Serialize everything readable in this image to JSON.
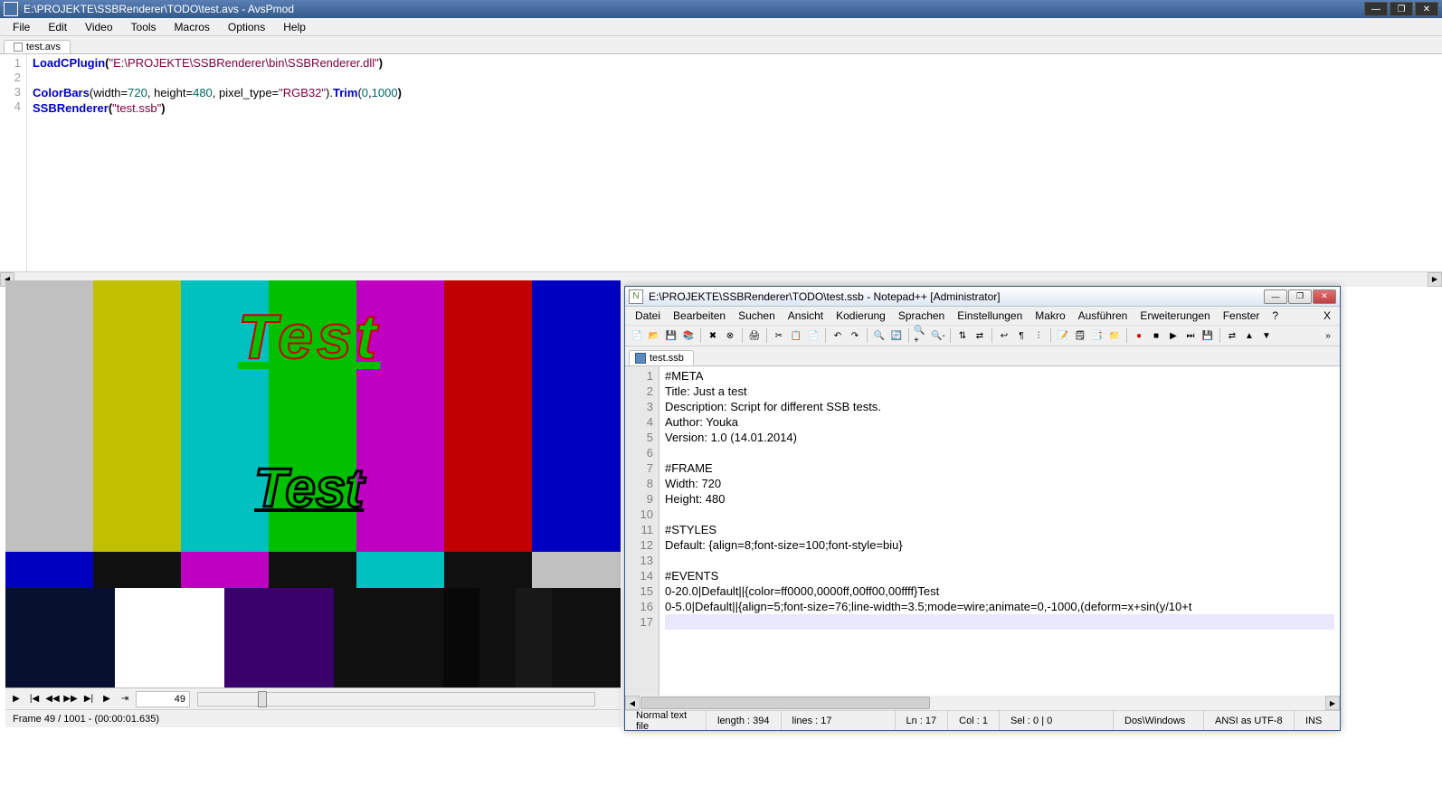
{
  "avspmod": {
    "title": "E:\\PROJEKTE\\SSBRenderer\\TODO\\test.avs - AvsPmod",
    "menu": [
      "File",
      "Edit",
      "Video",
      "Tools",
      "Macros",
      "Options",
      "Help"
    ],
    "tab": "test.avs",
    "code": {
      "line1_fn": "LoadCPlugin",
      "line1_str": "\"E:\\PROJEKTE\\SSBRenderer\\bin\\SSBRenderer.dll\"",
      "line3_fn1": "ColorBars",
      "line3_args_a": "(width=",
      "line3_w": "720",
      "line3_args_b": ", height=",
      "line3_h": "480",
      "line3_args_c": ", pixel_type=",
      "line3_pt": "\"RGB32\"",
      "line3_args_d": ").",
      "line3_fn2": "Trim",
      "line3_args_e": "(",
      "line3_t0": "0",
      "line3_comma": ",",
      "line3_t1": "1000",
      "line3_close": ")",
      "line4_fn": "SSBRenderer",
      "line4_open": "(",
      "line4_str": "\"test.ssb\"",
      "line4_close": ")"
    },
    "gutter": [
      "1",
      "2",
      "3",
      "4"
    ],
    "frame_input": "49",
    "status": "Frame 49 / 1001  -  (00:00:01.635)",
    "preview": {
      "text1": "Test",
      "text2": "Test"
    }
  },
  "npp": {
    "title": "E:\\PROJEKTE\\SSBRenderer\\TODO\\test.ssb - Notepad++ [Administrator]",
    "menu": [
      "Datei",
      "Bearbeiten",
      "Suchen",
      "Ansicht",
      "Kodierung",
      "Sprachen",
      "Einstellungen",
      "Makro",
      "Ausführen",
      "Erweiterungen",
      "Fenster",
      "?"
    ],
    "tab": "test.ssb",
    "gutter": [
      "1",
      "2",
      "3",
      "4",
      "5",
      "6",
      "7",
      "8",
      "9",
      "10",
      "11",
      "12",
      "13",
      "14",
      "15",
      "16",
      "17"
    ],
    "lines": [
      "#META",
      "Title: Just a test",
      "Description: Script for different SSB tests.",
      "Author: Youka",
      "Version: 1.0 (14.01.2014)",
      "",
      "#FRAME",
      "Width: 720",
      "Height: 480",
      "",
      "#STYLES",
      "Default: {align=8;font-size=100;font-style=biu}",
      "",
      "#EVENTS",
      "0-20.0|Default||{color=ff0000,0000ff,00ff00,00ffff}Test",
      "0-5.0|Default||{align=5;font-size=76;line-width=3.5;mode=wire;animate=0,-1000,(deform=x+sin(y/10+t",
      ""
    ],
    "status": {
      "filetype": "Normal text file",
      "length": "length : 394",
      "lines": "lines : 17",
      "ln": "Ln : 17",
      "col": "Col : 1",
      "sel": "Sel : 0 | 0",
      "eol": "Dos\\Windows",
      "enc": "ANSI as UTF-8",
      "mode": "INS"
    }
  }
}
